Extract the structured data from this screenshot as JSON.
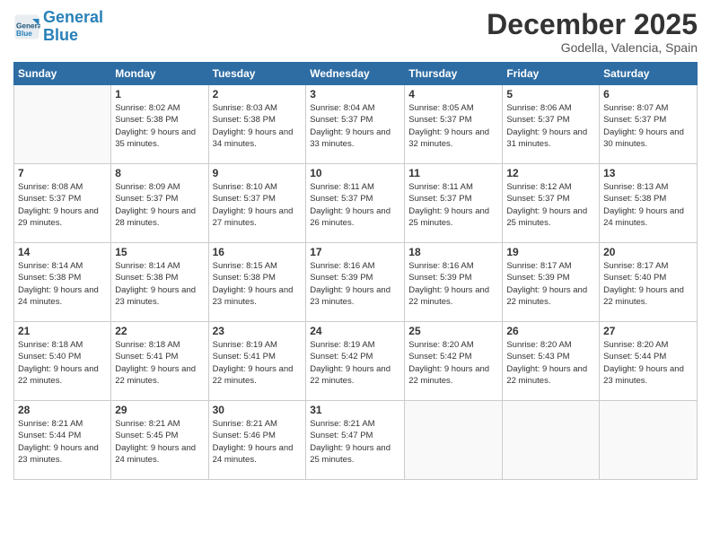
{
  "header": {
    "logo_line1": "General",
    "logo_line2": "Blue",
    "month_title": "December 2025",
    "location": "Godella, Valencia, Spain"
  },
  "days_of_week": [
    "Sunday",
    "Monday",
    "Tuesday",
    "Wednesday",
    "Thursday",
    "Friday",
    "Saturday"
  ],
  "weeks": [
    [
      {
        "day": "",
        "sunrise": "",
        "sunset": "",
        "daylight": "",
        "empty": true
      },
      {
        "day": "1",
        "sunrise": "Sunrise: 8:02 AM",
        "sunset": "Sunset: 5:38 PM",
        "daylight": "Daylight: 9 hours and 35 minutes."
      },
      {
        "day": "2",
        "sunrise": "Sunrise: 8:03 AM",
        "sunset": "Sunset: 5:38 PM",
        "daylight": "Daylight: 9 hours and 34 minutes."
      },
      {
        "day": "3",
        "sunrise": "Sunrise: 8:04 AM",
        "sunset": "Sunset: 5:37 PM",
        "daylight": "Daylight: 9 hours and 33 minutes."
      },
      {
        "day": "4",
        "sunrise": "Sunrise: 8:05 AM",
        "sunset": "Sunset: 5:37 PM",
        "daylight": "Daylight: 9 hours and 32 minutes."
      },
      {
        "day": "5",
        "sunrise": "Sunrise: 8:06 AM",
        "sunset": "Sunset: 5:37 PM",
        "daylight": "Daylight: 9 hours and 31 minutes."
      },
      {
        "day": "6",
        "sunrise": "Sunrise: 8:07 AM",
        "sunset": "Sunset: 5:37 PM",
        "daylight": "Daylight: 9 hours and 30 minutes."
      }
    ],
    [
      {
        "day": "7",
        "sunrise": "Sunrise: 8:08 AM",
        "sunset": "Sunset: 5:37 PM",
        "daylight": "Daylight: 9 hours and 29 minutes."
      },
      {
        "day": "8",
        "sunrise": "Sunrise: 8:09 AM",
        "sunset": "Sunset: 5:37 PM",
        "daylight": "Daylight: 9 hours and 28 minutes."
      },
      {
        "day": "9",
        "sunrise": "Sunrise: 8:10 AM",
        "sunset": "Sunset: 5:37 PM",
        "daylight": "Daylight: 9 hours and 27 minutes."
      },
      {
        "day": "10",
        "sunrise": "Sunrise: 8:11 AM",
        "sunset": "Sunset: 5:37 PM",
        "daylight": "Daylight: 9 hours and 26 minutes."
      },
      {
        "day": "11",
        "sunrise": "Sunrise: 8:11 AM",
        "sunset": "Sunset: 5:37 PM",
        "daylight": "Daylight: 9 hours and 25 minutes."
      },
      {
        "day": "12",
        "sunrise": "Sunrise: 8:12 AM",
        "sunset": "Sunset: 5:37 PM",
        "daylight": "Daylight: 9 hours and 25 minutes."
      },
      {
        "day": "13",
        "sunrise": "Sunrise: 8:13 AM",
        "sunset": "Sunset: 5:38 PM",
        "daylight": "Daylight: 9 hours and 24 minutes."
      }
    ],
    [
      {
        "day": "14",
        "sunrise": "Sunrise: 8:14 AM",
        "sunset": "Sunset: 5:38 PM",
        "daylight": "Daylight: 9 hours and 24 minutes."
      },
      {
        "day": "15",
        "sunrise": "Sunrise: 8:14 AM",
        "sunset": "Sunset: 5:38 PM",
        "daylight": "Daylight: 9 hours and 23 minutes."
      },
      {
        "day": "16",
        "sunrise": "Sunrise: 8:15 AM",
        "sunset": "Sunset: 5:38 PM",
        "daylight": "Daylight: 9 hours and 23 minutes."
      },
      {
        "day": "17",
        "sunrise": "Sunrise: 8:16 AM",
        "sunset": "Sunset: 5:39 PM",
        "daylight": "Daylight: 9 hours and 23 minutes."
      },
      {
        "day": "18",
        "sunrise": "Sunrise: 8:16 AM",
        "sunset": "Sunset: 5:39 PM",
        "daylight": "Daylight: 9 hours and 22 minutes."
      },
      {
        "day": "19",
        "sunrise": "Sunrise: 8:17 AM",
        "sunset": "Sunset: 5:39 PM",
        "daylight": "Daylight: 9 hours and 22 minutes."
      },
      {
        "day": "20",
        "sunrise": "Sunrise: 8:17 AM",
        "sunset": "Sunset: 5:40 PM",
        "daylight": "Daylight: 9 hours and 22 minutes."
      }
    ],
    [
      {
        "day": "21",
        "sunrise": "Sunrise: 8:18 AM",
        "sunset": "Sunset: 5:40 PM",
        "daylight": "Daylight: 9 hours and 22 minutes."
      },
      {
        "day": "22",
        "sunrise": "Sunrise: 8:18 AM",
        "sunset": "Sunset: 5:41 PM",
        "daylight": "Daylight: 9 hours and 22 minutes."
      },
      {
        "day": "23",
        "sunrise": "Sunrise: 8:19 AM",
        "sunset": "Sunset: 5:41 PM",
        "daylight": "Daylight: 9 hours and 22 minutes."
      },
      {
        "day": "24",
        "sunrise": "Sunrise: 8:19 AM",
        "sunset": "Sunset: 5:42 PM",
        "daylight": "Daylight: 9 hours and 22 minutes."
      },
      {
        "day": "25",
        "sunrise": "Sunrise: 8:20 AM",
        "sunset": "Sunset: 5:42 PM",
        "daylight": "Daylight: 9 hours and 22 minutes."
      },
      {
        "day": "26",
        "sunrise": "Sunrise: 8:20 AM",
        "sunset": "Sunset: 5:43 PM",
        "daylight": "Daylight: 9 hours and 22 minutes."
      },
      {
        "day": "27",
        "sunrise": "Sunrise: 8:20 AM",
        "sunset": "Sunset: 5:44 PM",
        "daylight": "Daylight: 9 hours and 23 minutes."
      }
    ],
    [
      {
        "day": "28",
        "sunrise": "Sunrise: 8:21 AM",
        "sunset": "Sunset: 5:44 PM",
        "daylight": "Daylight: 9 hours and 23 minutes."
      },
      {
        "day": "29",
        "sunrise": "Sunrise: 8:21 AM",
        "sunset": "Sunset: 5:45 PM",
        "daylight": "Daylight: 9 hours and 24 minutes."
      },
      {
        "day": "30",
        "sunrise": "Sunrise: 8:21 AM",
        "sunset": "Sunset: 5:46 PM",
        "daylight": "Daylight: 9 hours and 24 minutes."
      },
      {
        "day": "31",
        "sunrise": "Sunrise: 8:21 AM",
        "sunset": "Sunset: 5:47 PM",
        "daylight": "Daylight: 9 hours and 25 minutes."
      },
      {
        "day": "",
        "sunrise": "",
        "sunset": "",
        "daylight": "",
        "empty": true
      },
      {
        "day": "",
        "sunrise": "",
        "sunset": "",
        "daylight": "",
        "empty": true
      },
      {
        "day": "",
        "sunrise": "",
        "sunset": "",
        "daylight": "",
        "empty": true
      }
    ]
  ]
}
